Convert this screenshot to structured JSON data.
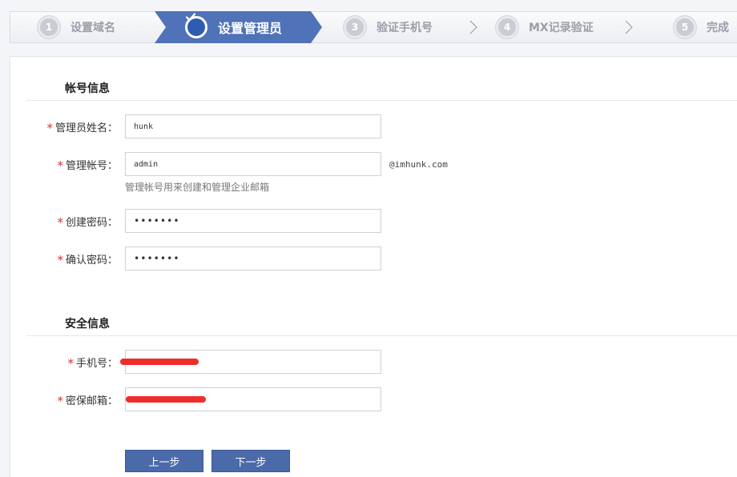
{
  "steps": [
    {
      "num": "1",
      "label": "设置域名",
      "state": "done"
    },
    {
      "num": "✓",
      "label": "设置管理员",
      "state": "active"
    },
    {
      "num": "3",
      "label": "验证手机号",
      "state": "pending"
    },
    {
      "num": "4",
      "label": "MX记录验证",
      "state": "pending"
    },
    {
      "num": "5",
      "label": "完成",
      "state": "pending"
    }
  ],
  "account_section": {
    "title": "帐号信息",
    "admin_name": {
      "label": "管理员姓名：",
      "value": "hunk"
    },
    "admin_account": {
      "label": "管理帐号：",
      "value": "admin",
      "suffix": "@imhunk.com",
      "hint": "管理帐号用来创建和管理企业邮箱"
    },
    "create_password": {
      "label": "创建密码：",
      "value": "•••••••"
    },
    "confirm_password": {
      "label": "确认密码：",
      "value": "•••••••"
    }
  },
  "security_section": {
    "title": "安全信息",
    "phone": {
      "label": "手机号：",
      "value": ""
    },
    "backup_email": {
      "label": "密保邮箱：",
      "value": ""
    }
  },
  "buttons": {
    "prev": "上一步",
    "next": "下一步"
  },
  "colors": {
    "accent": "#4a6aaa",
    "active_step": "#4f72b8",
    "required": "#d8322c",
    "redaction": "#f02c2c"
  },
  "icons": {
    "active_step": "check-icon",
    "step_separator": "chevron-right-icon"
  }
}
